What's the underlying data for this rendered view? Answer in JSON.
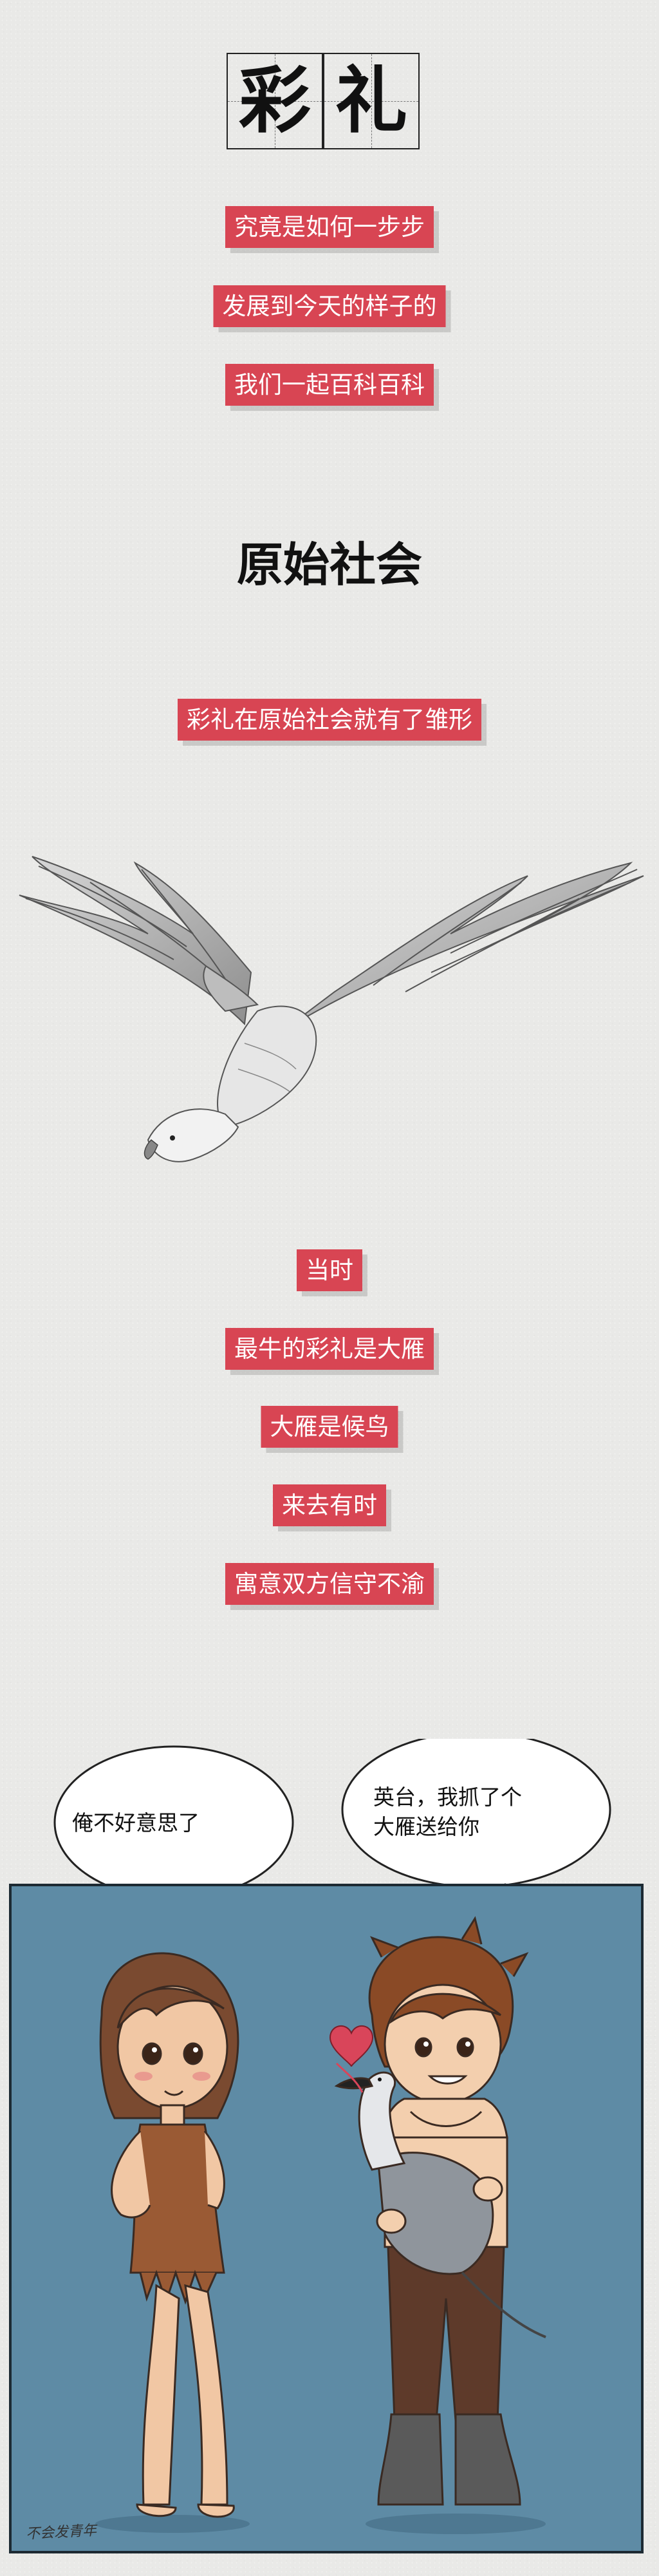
{
  "title": {
    "char1": "彩",
    "char2": "礼"
  },
  "intro_lines": [
    "究竟是如何一步步",
    "发展到今天的样子的",
    "我们一起百科百科"
  ],
  "section": {
    "heading": "原始社会",
    "subtitle": "彩礼在原始社会就有了雏形"
  },
  "facts": [
    "当时",
    "最牛的彩礼是大雁",
    "大雁是候鸟",
    "来去有时",
    "寓意双方信守不渝"
  ],
  "comic": {
    "left_bubble": "俺不好意思了",
    "right_bubble_line1": "英台，我抓了个",
    "right_bubble_line2": "大雁送给你",
    "signature": "不会发青年"
  },
  "colors": {
    "background": "#e9e9e7",
    "tag_red": "#d84553",
    "panel_blue": "#5e8ba5"
  },
  "icons": [
    "flying-eagle-illustration",
    "heart-icon",
    "goose-illustration"
  ]
}
